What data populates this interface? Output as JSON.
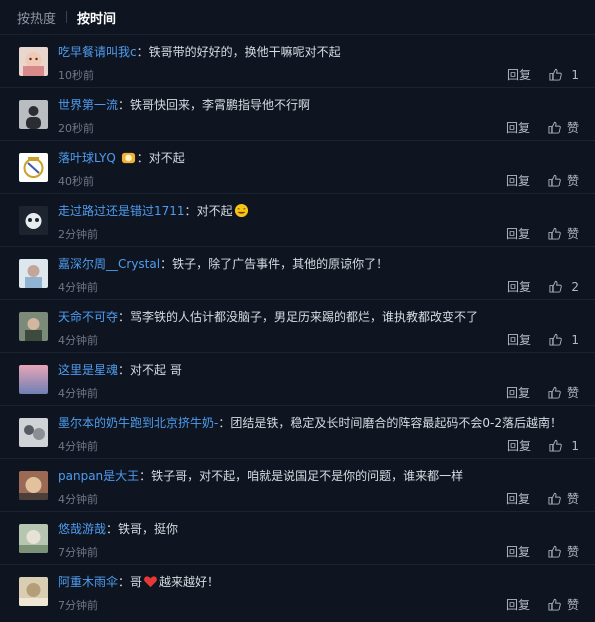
{
  "tabs": {
    "hot": "按热度",
    "time": "按时间"
  },
  "labels": {
    "reply": "回复"
  },
  "comments": [
    {
      "user": "吃早餐请叫我c",
      "text": "铁哥带的好好的，换他干嘛呢对不起",
      "time": "10秒前",
      "likes": "1"
    },
    {
      "user": "世界第一流",
      "text": "铁哥快回来，李霄鹏指导他不行啊",
      "time": "20秒前",
      "likes": "赞"
    },
    {
      "user": "落叶球LYQ",
      "text": "对不起",
      "time": "40秒前",
      "likes": "赞"
    },
    {
      "user": "走过路过还是错过1711",
      "text": "对不起",
      "time": "2分钟前",
      "likes": "赞"
    },
    {
      "user": "嘉深尔周__Crystal",
      "text": "铁子，除了广告事件，其他的原谅你了！",
      "time": "4分钟前",
      "likes": "2"
    },
    {
      "user": "天命不可夺",
      "text": "骂李铁的人估计都没脑子，男足历来踢的都烂，谁执教都改变不了",
      "time": "4分钟前",
      "likes": "1"
    },
    {
      "user": "这里是星魂",
      "text": "对不起 哥",
      "time": "4分钟前",
      "likes": "赞"
    },
    {
      "user": "墨尔本的奶牛跑到北京挤牛奶-",
      "text": "团结是铁，稳定及长时间磨合的阵容最起码不会0-2落后越南！",
      "time": "4分钟前",
      "likes": "1"
    },
    {
      "user": "panpan是大王",
      "text": "铁子哥，对不起，咱就是说国足不是你的问题，谁来都一样",
      "time": "4分钟前",
      "likes": "赞"
    },
    {
      "user": "悠哉游哉",
      "text": "铁哥，挺你",
      "time": "7分钟前",
      "likes": "赞"
    },
    {
      "user": "阿重木雨伞",
      "text_before": "哥",
      "text_after": "越来越好！",
      "time": "7分钟前",
      "likes": "赞"
    }
  ]
}
